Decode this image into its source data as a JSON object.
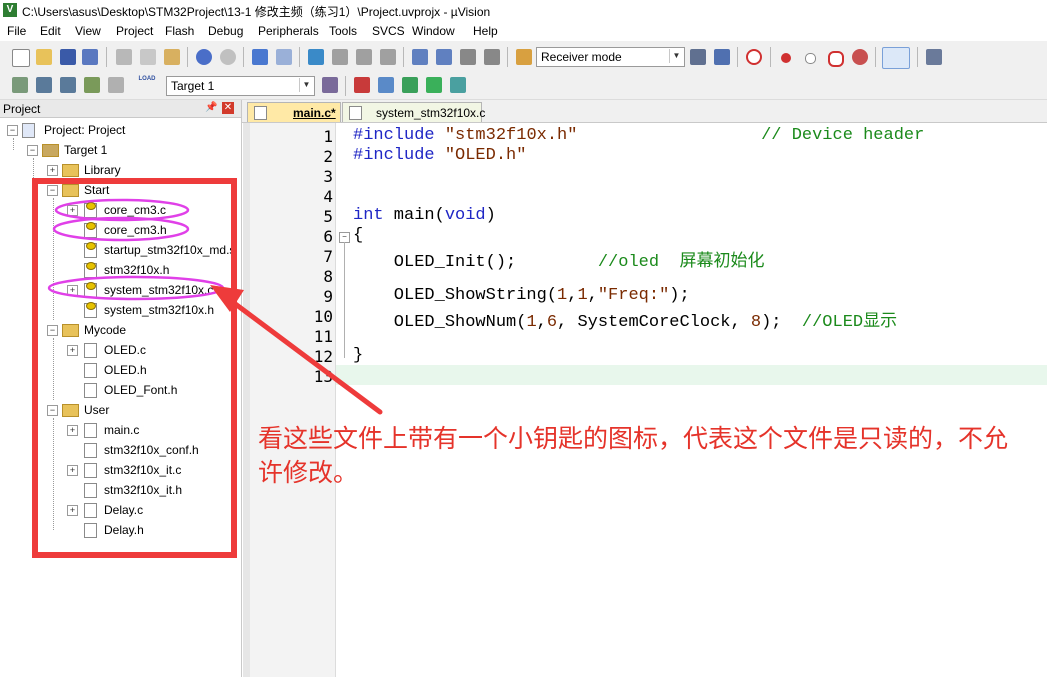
{
  "window": {
    "title": "C:\\Users\\asus\\Desktop\\STM32Project\\13-1 修改主频（练习1）\\Project.uvprojx - µVision",
    "app_icon": "V"
  },
  "menubar": {
    "items": [
      "File",
      "Edit",
      "View",
      "Project",
      "Flash",
      "Debug",
      "Peripherals",
      "Tools",
      "SVCS",
      "Window",
      "Help"
    ]
  },
  "toolbar": {
    "target_combo": "Receiver mode",
    "build_target": "Target 1",
    "load_label": "LOAD"
  },
  "project_panel": {
    "title": "Project",
    "pin_icon": "pin-icon",
    "root": "Project: Project",
    "target": "Target 1",
    "groups": [
      {
        "name": "Library",
        "files": []
      },
      {
        "name": "Start",
        "files": [
          "core_cm3.c",
          "core_cm3.h",
          "startup_stm32f10x_md.s",
          "stm32f10x.h",
          "system_stm32f10x.c",
          "system_stm32f10x.h"
        ]
      },
      {
        "name": "Mycode",
        "files": [
          "OLED.c",
          "OLED.h",
          "OLED_Font.h"
        ]
      },
      {
        "name": "User",
        "files": [
          "main.c",
          "stm32f10x_conf.h",
          "stm32f10x_it.c",
          "stm32f10x_it.h",
          "Delay.c",
          "Delay.h"
        ]
      }
    ]
  },
  "tabs": [
    {
      "label": "main.c*",
      "active": true
    },
    {
      "label": "system_stm32f10x.c",
      "active": false
    }
  ],
  "editor": {
    "line_numbers": [
      "1",
      "2",
      "3",
      "4",
      "5",
      "6",
      "7",
      "8",
      "9",
      "10",
      "11",
      "12",
      "13"
    ],
    "lines": [
      {
        "n": "1",
        "pp": "#include",
        "str": " \"stm32f10x.h\"",
        "cmt": "                  // Device header"
      },
      {
        "n": "2",
        "pp": "#include",
        "str": " \"OLED.h\""
      },
      {
        "n": "5",
        "kw1": "int",
        "mid": " main(",
        "kw2": "void",
        "end": ")"
      },
      {
        "n": "6",
        "text": "{"
      },
      {
        "n": "7",
        "code": "    OLED_Init();",
        "cmt": "        //oled  屏幕初始化"
      },
      {
        "n": "9",
        "pre": "    OLED_ShowString(",
        "n1": "1",
        "c1": ",",
        "n2": "1",
        "c2": ",",
        "s": "\"Freq:\"",
        "post": ");"
      },
      {
        "n": "10",
        "pre": "    OLED_ShowNum(",
        "n1": "1",
        "c1": ",",
        "n2": "6",
        "mid": ", SystemCoreClock, ",
        "n3": "8",
        "post": ");",
        "cmt": "  //OLED显示"
      },
      {
        "n": "12",
        "text": "}"
      }
    ]
  },
  "annotation": {
    "text": "看这些文件上带有一个小钥匙的图标，代表这个文件是只读的，不允许修改。",
    "color": "#e5332a"
  },
  "colors": {
    "accent_red": "#ee3b3b",
    "highlight_magenta": "#e040e8",
    "active_tab": "#ffe9a6"
  }
}
